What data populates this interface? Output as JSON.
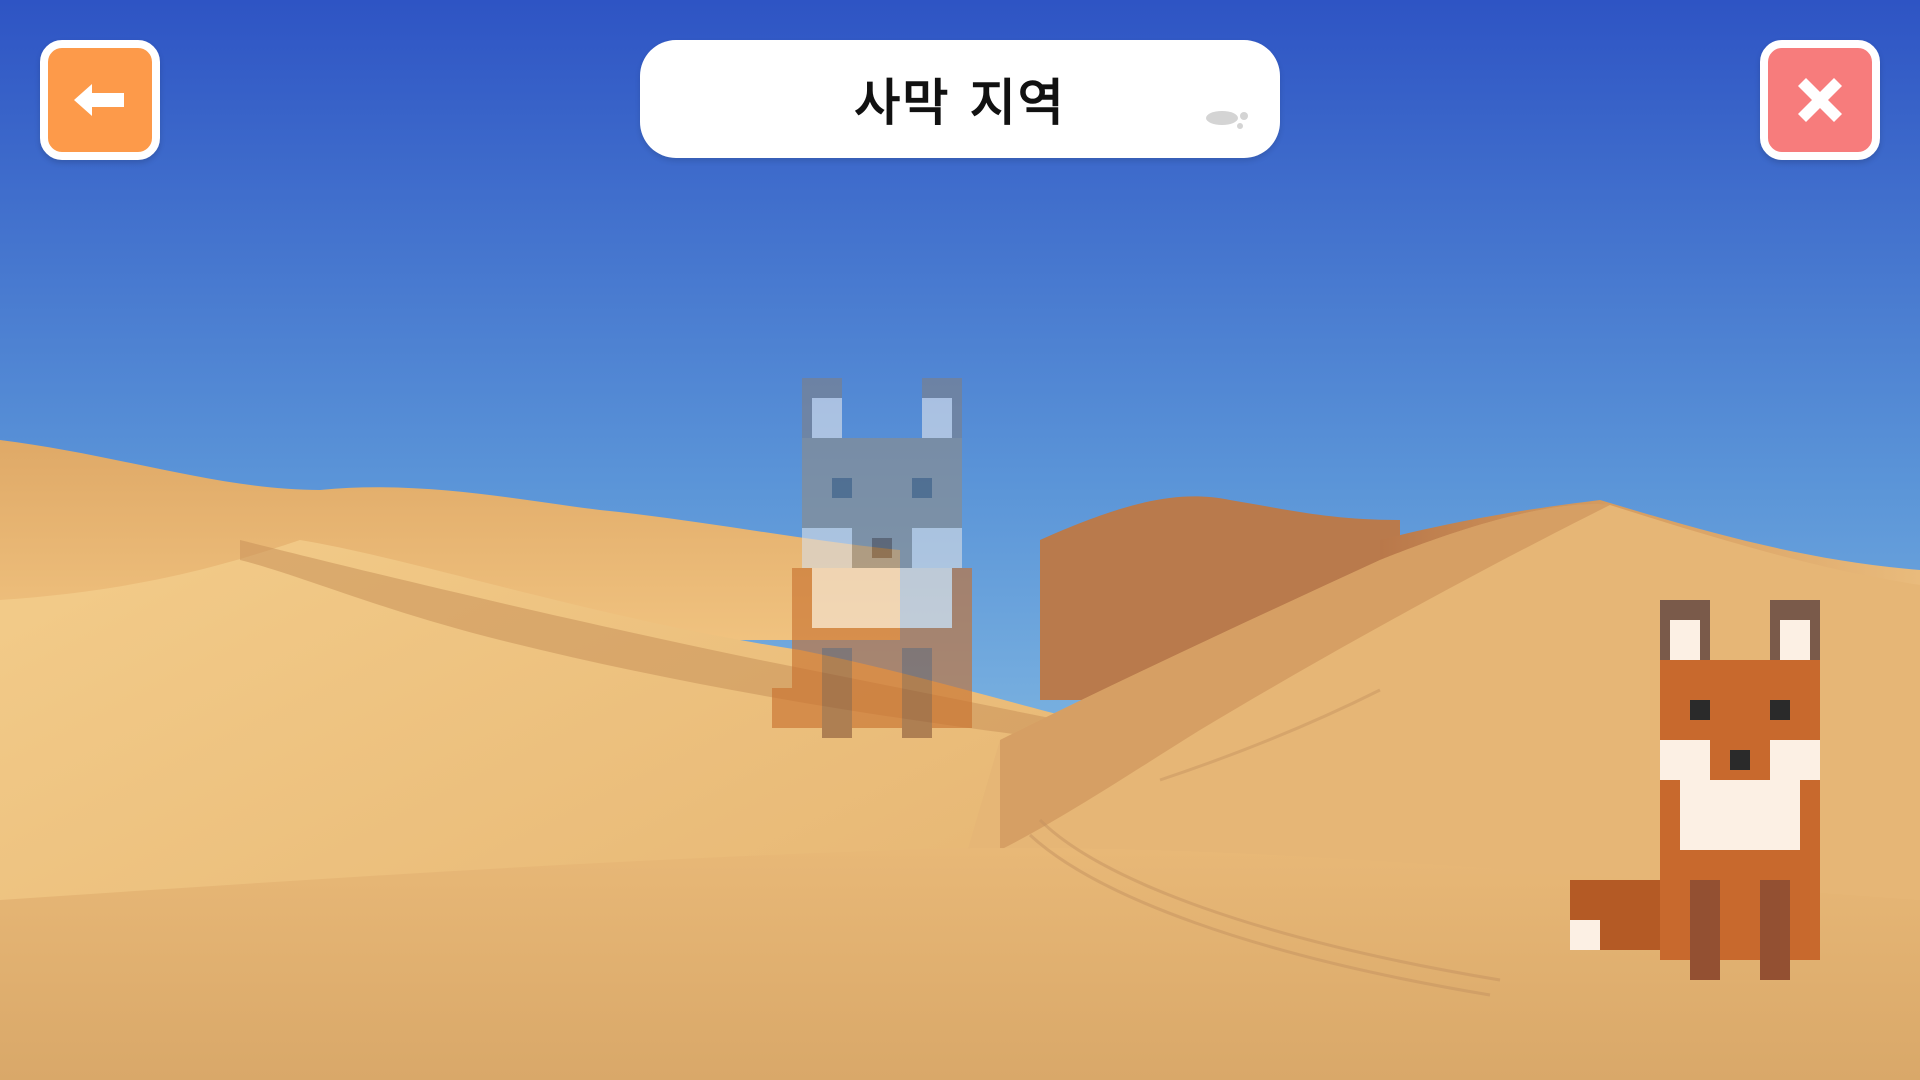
{
  "header": {
    "title": "사막 지역",
    "back_icon": "arrow-left-icon",
    "close_icon": "close-x-icon"
  },
  "colors": {
    "back_button": "#fd9a4a",
    "close_button": "#f77c7c",
    "sky_top": "#2f56c4",
    "sky_bottom": "#9ed4ea",
    "sand_light": "#f4cd8c",
    "sand_mid": "#e2ae6c",
    "sand_dark": "#c28650",
    "fox_orange": "#c8692d",
    "fox_dark": "#935032",
    "fox_cream": "#fcf0e4",
    "fox_ear_outline": "#7a5a4a",
    "fox_silhouette_tint": "#8a8e95"
  },
  "scene": {
    "background": "desert-dunes",
    "silhouette_target": "fox",
    "player_character": "fox"
  }
}
